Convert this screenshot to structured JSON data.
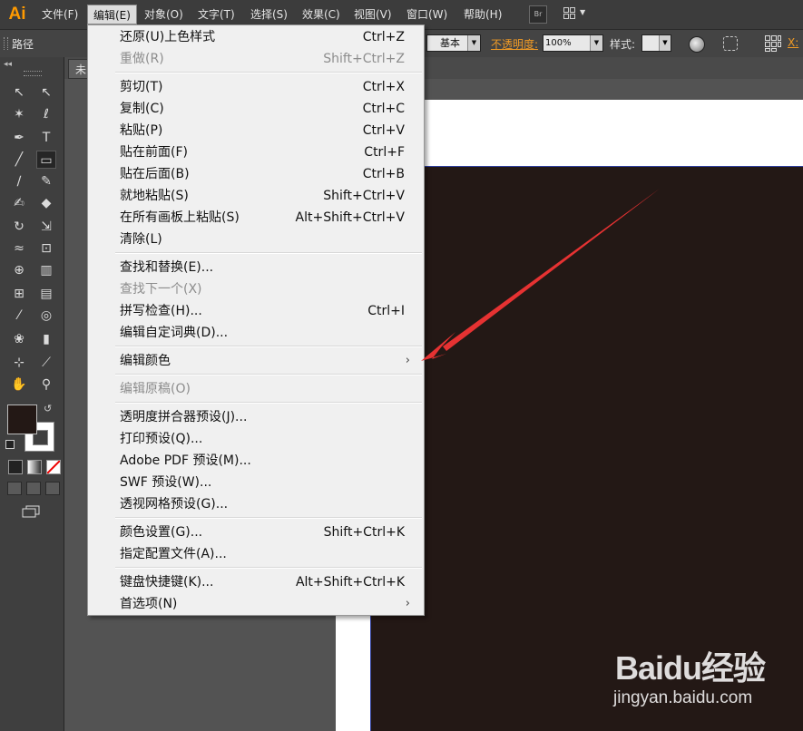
{
  "app": {
    "logo": "Ai"
  },
  "menubar": {
    "items": [
      {
        "label": "文件(F)"
      },
      {
        "label": "编辑(E)"
      },
      {
        "label": "对象(O)"
      },
      {
        "label": "文字(T)"
      },
      {
        "label": "选择(S)"
      },
      {
        "label": "效果(C)"
      },
      {
        "label": "视图(V)"
      },
      {
        "label": "窗口(W)"
      },
      {
        "label": "帮助(H)"
      }
    ],
    "bridge_label": "Br"
  },
  "controlbar": {
    "selection_label": "路径",
    "brush_value": "基本",
    "opacity_label": "不透明度:",
    "opacity_value": "100%",
    "style_label": "样式:",
    "x_label": "X:"
  },
  "document": {
    "tab_label": "未"
  },
  "edit_menu": {
    "groups": [
      [
        {
          "label": "还原(U)上色样式",
          "shortcut": "Ctrl+Z",
          "enabled": true
        },
        {
          "label": "重做(R)",
          "shortcut": "Shift+Ctrl+Z",
          "enabled": false
        }
      ],
      [
        {
          "label": "剪切(T)",
          "shortcut": "Ctrl+X",
          "enabled": true
        },
        {
          "label": "复制(C)",
          "shortcut": "Ctrl+C",
          "enabled": true
        },
        {
          "label": "粘贴(P)",
          "shortcut": "Ctrl+V",
          "enabled": true
        },
        {
          "label": "贴在前面(F)",
          "shortcut": "Ctrl+F",
          "enabled": true
        },
        {
          "label": "贴在后面(B)",
          "shortcut": "Ctrl+B",
          "enabled": true
        },
        {
          "label": "就地粘贴(S)",
          "shortcut": "Shift+Ctrl+V",
          "enabled": true
        },
        {
          "label": "在所有画板上粘贴(S)",
          "shortcut": "Alt+Shift+Ctrl+V",
          "enabled": true
        },
        {
          "label": "清除(L)",
          "shortcut": "",
          "enabled": true
        }
      ],
      [
        {
          "label": "查找和替换(E)...",
          "shortcut": "",
          "enabled": true
        },
        {
          "label": "查找下一个(X)",
          "shortcut": "",
          "enabled": false
        },
        {
          "label": "拼写检查(H)...",
          "shortcut": "Ctrl+I",
          "enabled": true
        },
        {
          "label": "编辑自定词典(D)...",
          "shortcut": "",
          "enabled": true
        }
      ],
      [
        {
          "label": "编辑颜色",
          "shortcut": "",
          "enabled": true,
          "submenu": true
        }
      ],
      [
        {
          "label": "编辑原稿(O)",
          "shortcut": "",
          "enabled": false
        }
      ],
      [
        {
          "label": "透明度拼合器预设(J)...",
          "shortcut": "",
          "enabled": true
        },
        {
          "label": "打印预设(Q)...",
          "shortcut": "",
          "enabled": true
        },
        {
          "label": "Adobe PDF 预设(M)...",
          "shortcut": "",
          "enabled": true
        },
        {
          "label": "SWF 预设(W)...",
          "shortcut": "",
          "enabled": true
        },
        {
          "label": "透视网格预设(G)...",
          "shortcut": "",
          "enabled": true
        }
      ],
      [
        {
          "label": "颜色设置(G)...",
          "shortcut": "Shift+Ctrl+K",
          "enabled": true
        },
        {
          "label": "指定配置文件(A)...",
          "shortcut": "",
          "enabled": true
        }
      ],
      [
        {
          "label": "键盘快捷键(K)...",
          "shortcut": "Alt+Shift+Ctrl+K",
          "enabled": true
        },
        {
          "label": "首选项(N)",
          "shortcut": "",
          "enabled": true,
          "submenu": true
        }
      ]
    ],
    "submenu_glyph": "›"
  },
  "colors": {
    "artboard_fill": "#231815",
    "accent_orange": "#f29b25",
    "annotation_arrow": "#e63232"
  },
  "watermark": {
    "brand": "Baidu经验",
    "url": "jingyan.baidu.com"
  }
}
